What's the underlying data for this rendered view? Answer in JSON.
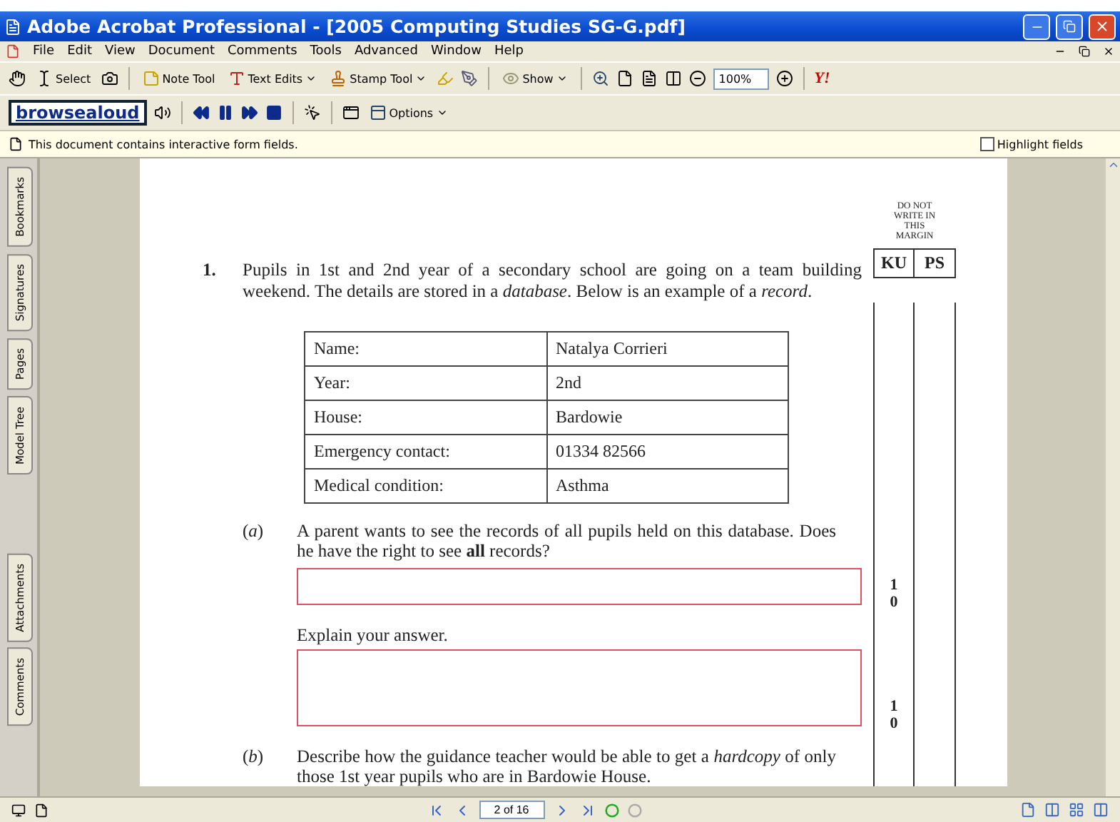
{
  "window": {
    "title": "Adobe Acrobat Professional - [2005 Computing Studies SG-G.pdf]"
  },
  "menu": [
    "File",
    "Edit",
    "View",
    "Document",
    "Comments",
    "Tools",
    "Advanced",
    "Window",
    "Help"
  ],
  "toolbar": {
    "select": "Select",
    "note_tool": "Note Tool",
    "text_edits": "Text Edits",
    "stamp_tool": "Stamp Tool",
    "show": "Show",
    "zoom": "100%",
    "yahoo": "Y!"
  },
  "reader_toolbar": {
    "logo": "browsealoud",
    "options": "Options"
  },
  "info_bar": {
    "message": "This document contains interactive form fields.",
    "highlight_fields": {
      "label": "Highlight fields",
      "checked": false
    }
  },
  "nav_tabs": [
    {
      "label": "Bookmarks",
      "selected": false
    },
    {
      "label": "Signatures",
      "selected": false
    },
    {
      "label": "Pages",
      "selected": false
    },
    {
      "label": "Model Tree",
      "selected": false
    },
    {
      "label": "Attachments",
      "selected": false
    },
    {
      "label": "Comments",
      "selected": false
    }
  ],
  "document": {
    "margin_note": "DO NOT WRITE IN THIS MARGIN",
    "margin_columns": [
      "KU",
      "PS"
    ],
    "question": {
      "number": "1.",
      "text": "Pupils in 1st and 2nd year of a secondary school are going on a team building weekend.  The details are stored in a *database*.  Below is an example of a *record*."
    },
    "record_table": [
      {
        "field": "Name:",
        "value": "Natalya Corrieri"
      },
      {
        "field": "Year:",
        "value": "2nd"
      },
      {
        "field": "House:",
        "value": "Bardowie"
      },
      {
        "field": "Emergency contact:",
        "value": "01334 82566"
      },
      {
        "field": "Medical condition:",
        "value": "Asthma"
      }
    ],
    "parts": [
      {
        "label": "(*a*)",
        "text": "A parent wants to see the records of all pupils held on this database. Does he have the right to see **all** records?",
        "items": [
          {
            "kind": "short_answer",
            "marks": [
              "1",
              "0"
            ]
          },
          {
            "kind": "prompt",
            "text": "Explain your answer."
          },
          {
            "kind": "long_answer",
            "marks": [
              "1",
              "0"
            ]
          }
        ]
      },
      {
        "label": "(*b*)",
        "text": "Describe how the guidance teacher would be able to get a *hardcopy* of only those 1st year pupils who are in Bardowie House."
      }
    ]
  },
  "status_bar": {
    "page": "2 of 16"
  }
}
